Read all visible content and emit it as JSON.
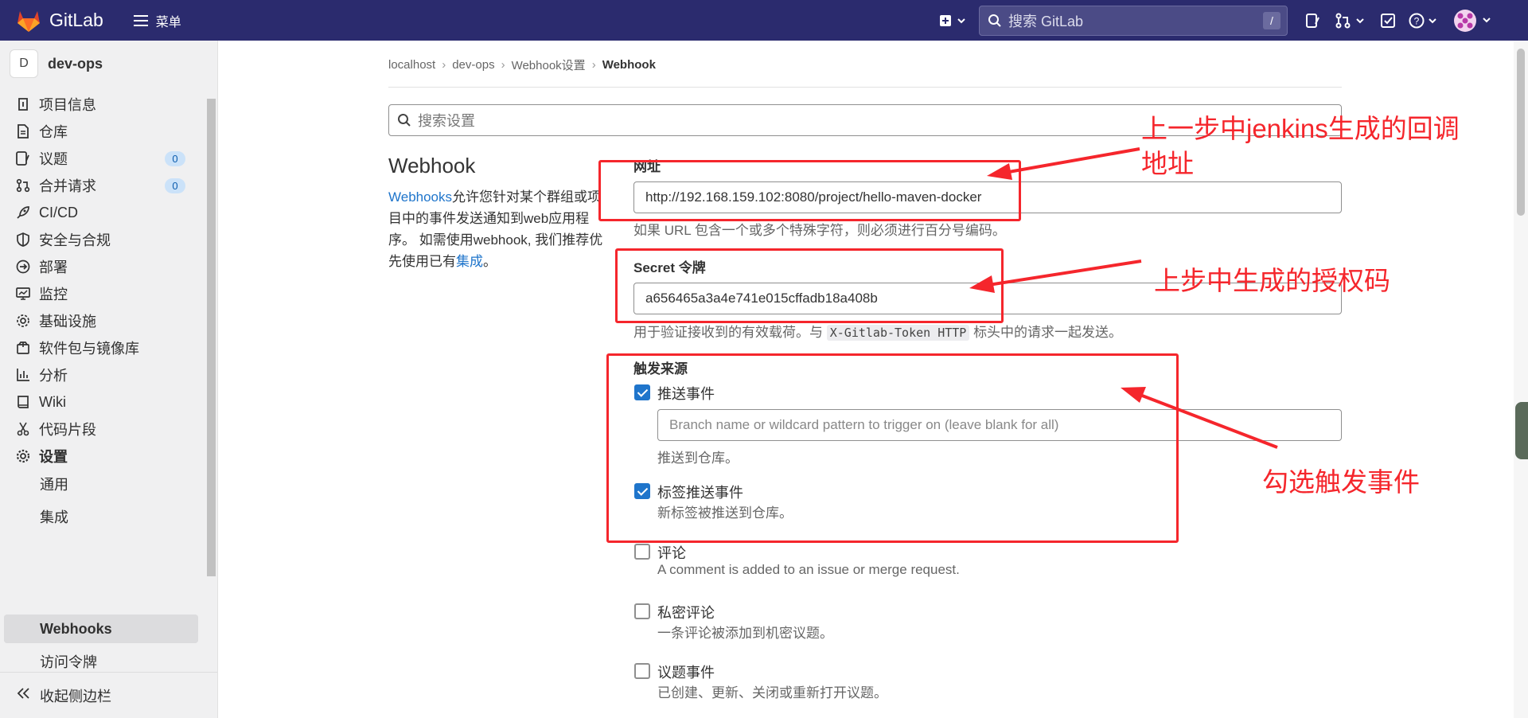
{
  "topbar": {
    "logo_text": "GitLab",
    "menu_label": "菜单",
    "search_placeholder": "搜索 GitLab",
    "search_shortcut": "/"
  },
  "sidebar": {
    "project_initial": "D",
    "project_name": "dev-ops",
    "items": [
      {
        "label": "项目信息",
        "icon": "info-icon"
      },
      {
        "label": "仓库",
        "icon": "file-icon"
      },
      {
        "label": "议题",
        "icon": "issues-icon",
        "badge": "0"
      },
      {
        "label": "合并请求",
        "icon": "merge-request-icon",
        "badge": "0"
      },
      {
        "label": "CI/CD",
        "icon": "rocket-icon"
      },
      {
        "label": "安全与合规",
        "icon": "shield-icon"
      },
      {
        "label": "部署",
        "icon": "deployments-icon"
      },
      {
        "label": "监控",
        "icon": "monitor-icon"
      },
      {
        "label": "基础设施",
        "icon": "cloud-gear-icon"
      },
      {
        "label": "软件包与镜像库",
        "icon": "package-icon"
      },
      {
        "label": "分析",
        "icon": "chart-icon"
      },
      {
        "label": "Wiki",
        "icon": "book-icon"
      },
      {
        "label": "代码片段",
        "icon": "scissors-icon"
      },
      {
        "label": "设置",
        "icon": "settings-icon"
      }
    ],
    "sub_items": [
      {
        "label": "通用"
      },
      {
        "label": "集成"
      },
      {
        "label": "Webhooks"
      },
      {
        "label": "访问令牌"
      }
    ],
    "collapse_label": "收起侧边栏"
  },
  "breadcrumb": {
    "items": [
      "localhost",
      "dev-ops",
      "Webhook设置",
      "Webhook"
    ]
  },
  "settings_search": {
    "placeholder": "搜索设置"
  },
  "webhook": {
    "title": "Webhook",
    "desc_link": "Webhooks",
    "desc_text": "允许您针对某个群组或项目中的事件发送通知到web应用程序。 如需使用webhook, 我们推荐优先使用已有",
    "desc_link2": "集成",
    "desc_end": "。"
  },
  "form": {
    "url_label": "网址",
    "url_value": "http://192.168.159.102:8080/project/hello-maven-docker",
    "url_help": "如果 URL 包含一个或多个特殊字符，则必须进行百分号编码。",
    "secret_label": "Secret 令牌",
    "secret_value": "a656465a3a4e741e015cffadb18a408b",
    "secret_help_pre": "用于验证接收到的有效载荷。与",
    "secret_help_code": "X-Gitlab-Token HTTP",
    "secret_help_post": "标头中的请求一起发送。",
    "trigger_label": "触发来源",
    "push_label": "推送事件",
    "push_checked": true,
    "branch_placeholder": "Branch name or wildcard pattern to trigger on (leave blank for all)",
    "push_help": "推送到仓库。",
    "tag_label": "标签推送事件",
    "tag_checked": true,
    "tag_help": "新标签被推送到仓库。",
    "comment_label": "评论",
    "comment_checked": false,
    "comment_help": "A comment is added to an issue or merge request.",
    "private_comment_label": "私密评论",
    "private_comment_checked": false,
    "private_comment_help": "一条评论被添加到机密议题。",
    "issue_label": "议题事件",
    "issue_checked": false,
    "issue_help": "已创建、更新、关闭或重新打开议题。"
  },
  "annotations": {
    "callback_line1": "上一步中jenkins生成的回调",
    "callback_line2": "地址",
    "auth_code": "上步中生成的授权码",
    "trigger": "勾选触发事件",
    "color": "#f5262c"
  }
}
